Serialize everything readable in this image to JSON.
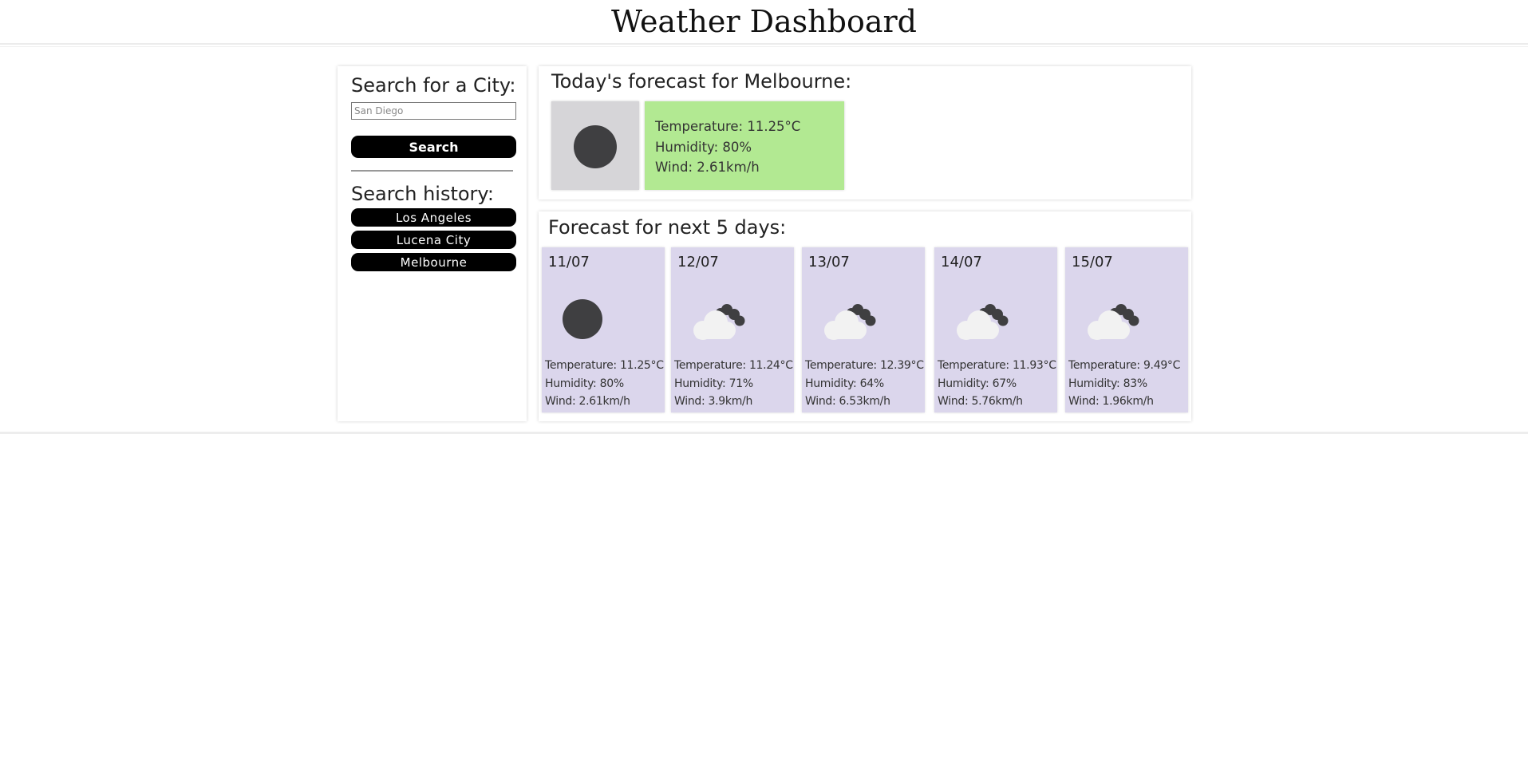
{
  "header": {
    "title": "Weather Dashboard"
  },
  "sidebar": {
    "search_title": "Search for a City:",
    "search_placeholder": "San Diego",
    "search_button": "Search",
    "history_title": "Search history:",
    "history": [
      "Los Angeles",
      "Lucena City",
      "Melbourne"
    ]
  },
  "today": {
    "title": "Today's forecast for Melbourne:",
    "icon": "moon-icon",
    "temperature": "Temperature: 11.25°C",
    "humidity": "Humidity: 80%",
    "wind": "Wind: 2.61km/h",
    "stats_color": "#b2e992"
  },
  "forecast": {
    "title": "Forecast for next 5 days:",
    "card_color": "#dbd6ec",
    "days": [
      {
        "date": "11/07",
        "icon": "moon-icon",
        "temperature": "Temperature: 11.25°C",
        "humidity": "Humidity: 80%",
        "wind": "Wind: 2.61km/h"
      },
      {
        "date": "12/07",
        "icon": "cloud-night-icon",
        "temperature": "Temperature: 11.24°C",
        "humidity": "Humidity: 71%",
        "wind": "Wind: 3.9km/h"
      },
      {
        "date": "13/07",
        "icon": "cloud-night-icon",
        "temperature": "Temperature: 12.39°C",
        "humidity": "Humidity: 64%",
        "wind": "Wind: 6.53km/h"
      },
      {
        "date": "14/07",
        "icon": "cloud-night-icon",
        "temperature": "Temperature: 11.93°C",
        "humidity": "Humidity: 67%",
        "wind": "Wind: 5.76km/h"
      },
      {
        "date": "15/07",
        "icon": "cloud-night-icon",
        "temperature": "Temperature: 9.49°C",
        "humidity": "Humidity: 83%",
        "wind": "Wind: 1.96km/h"
      }
    ]
  }
}
